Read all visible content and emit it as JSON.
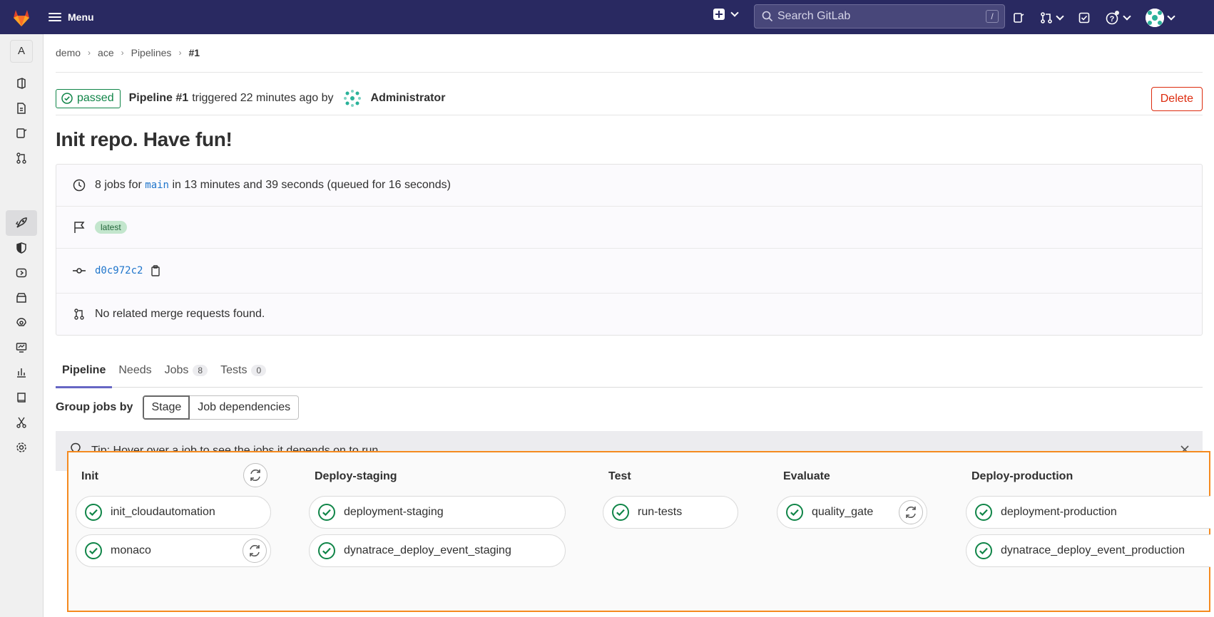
{
  "topbar": {
    "menu_label": "Menu",
    "search_placeholder": "Search GitLab",
    "search_shortcut": "/"
  },
  "sidebar": {
    "project_initial": "A",
    "items": [
      "project-overview",
      "repository",
      "issues",
      "merge-requests",
      "ci-cd",
      "security",
      "deployments",
      "packages",
      "infrastructure",
      "monitor",
      "analytics",
      "wiki",
      "snippets",
      "settings"
    ]
  },
  "breadcrumb": {
    "items": [
      "demo",
      "ace",
      "Pipelines"
    ],
    "current": "#1"
  },
  "pipeline": {
    "status": "passed",
    "name": "Pipeline #1",
    "triggered": "triggered 22 minutes ago by",
    "user": "Administrator",
    "delete_label": "Delete",
    "commit_title": "Init repo. Have fun!"
  },
  "info": {
    "jobs_prefix": "8 jobs for",
    "branch": "main",
    "duration": "in 13 minutes and 39 seconds (queued for 16 seconds)",
    "tag": "latest",
    "commit_sha": "d0c972c2",
    "mr_text": "No related merge requests found."
  },
  "tabs": [
    {
      "label": "Pipeline"
    },
    {
      "label": "Needs"
    },
    {
      "label": "Jobs",
      "count": "8"
    },
    {
      "label": "Tests",
      "count": "0"
    }
  ],
  "groupby": {
    "label": "Group jobs by",
    "options": [
      "Stage",
      "Job dependencies"
    ],
    "selected": "Stage"
  },
  "tip": {
    "text": "Tip: Hover over a job to see the jobs it depends on to run."
  },
  "stages": [
    {
      "name": "Init",
      "jobs": [
        "init_cloudautomation",
        "monaco"
      ]
    },
    {
      "name": "Deploy-staging",
      "jobs": [
        "deployment-staging",
        "dynatrace_deploy_event_staging"
      ]
    },
    {
      "name": "Test",
      "jobs": [
        "run-tests"
      ]
    },
    {
      "name": "Evaluate",
      "jobs": [
        "quality_gate"
      ]
    },
    {
      "name": "Deploy-production",
      "jobs": [
        "deployment-production",
        "dynatrace_deploy_event_production"
      ]
    }
  ],
  "colors": {
    "topbar": "#292961",
    "success": "#108548",
    "danger": "#dd2b0e",
    "link": "#1f75cb",
    "highlight": "#f58a1f"
  }
}
